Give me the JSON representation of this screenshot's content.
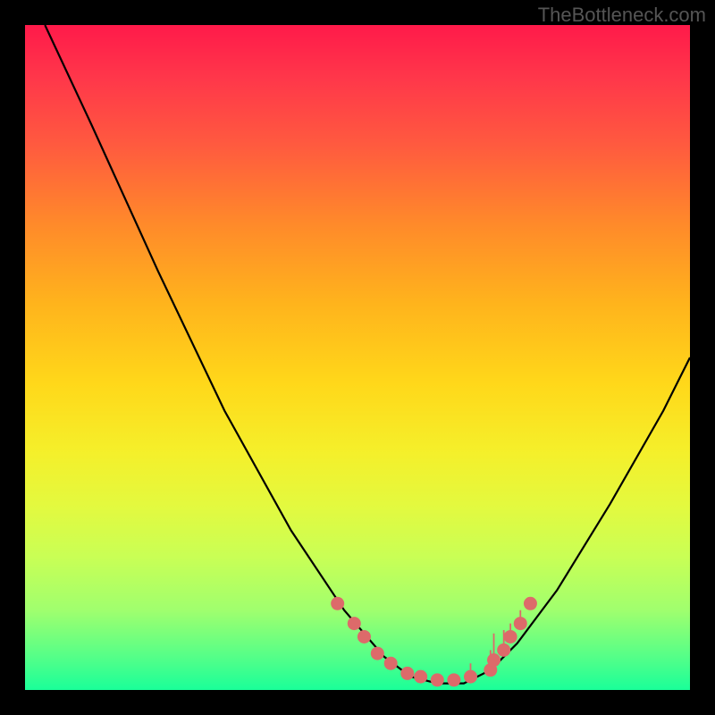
{
  "watermark": "TheBottleneck.com",
  "colors": {
    "background_frame": "#000000",
    "curve": "#000000",
    "dot_fill": "#dd6a6a",
    "gradient_top": "#ff1a4a",
    "gradient_bottom": "#1aff99"
  },
  "chart_data": {
    "type": "line",
    "title": "",
    "xlabel": "",
    "ylabel": "",
    "xlim": [
      0,
      100
    ],
    "ylim": [
      0,
      100
    ],
    "series": [
      {
        "name": "bottleneck-curve",
        "x": [
          3,
          10,
          20,
          30,
          40,
          48,
          54,
          58,
          62,
          66,
          70,
          74,
          80,
          88,
          96,
          100
        ],
        "y": [
          100,
          85,
          63,
          42,
          24,
          12,
          5,
          2,
          1,
          1,
          3,
          7,
          15,
          28,
          42,
          50
        ]
      }
    ],
    "highlight_points": {
      "name": "dots",
      "x": [
        47,
        49.5,
        51,
        53,
        55,
        57.5,
        59.5,
        62,
        64.5,
        67,
        70,
        70.5,
        72,
        73,
        74.5,
        76
      ],
      "y": [
        13,
        10,
        8,
        5.5,
        4,
        2.5,
        2,
        1.5,
        1.5,
        2,
        3,
        4.5,
        6,
        8,
        10,
        13
      ],
      "bar_height": [
        0,
        0,
        0,
        0,
        0,
        0,
        0,
        0,
        0,
        2,
        3,
        4,
        3,
        2,
        2,
        0
      ]
    }
  }
}
